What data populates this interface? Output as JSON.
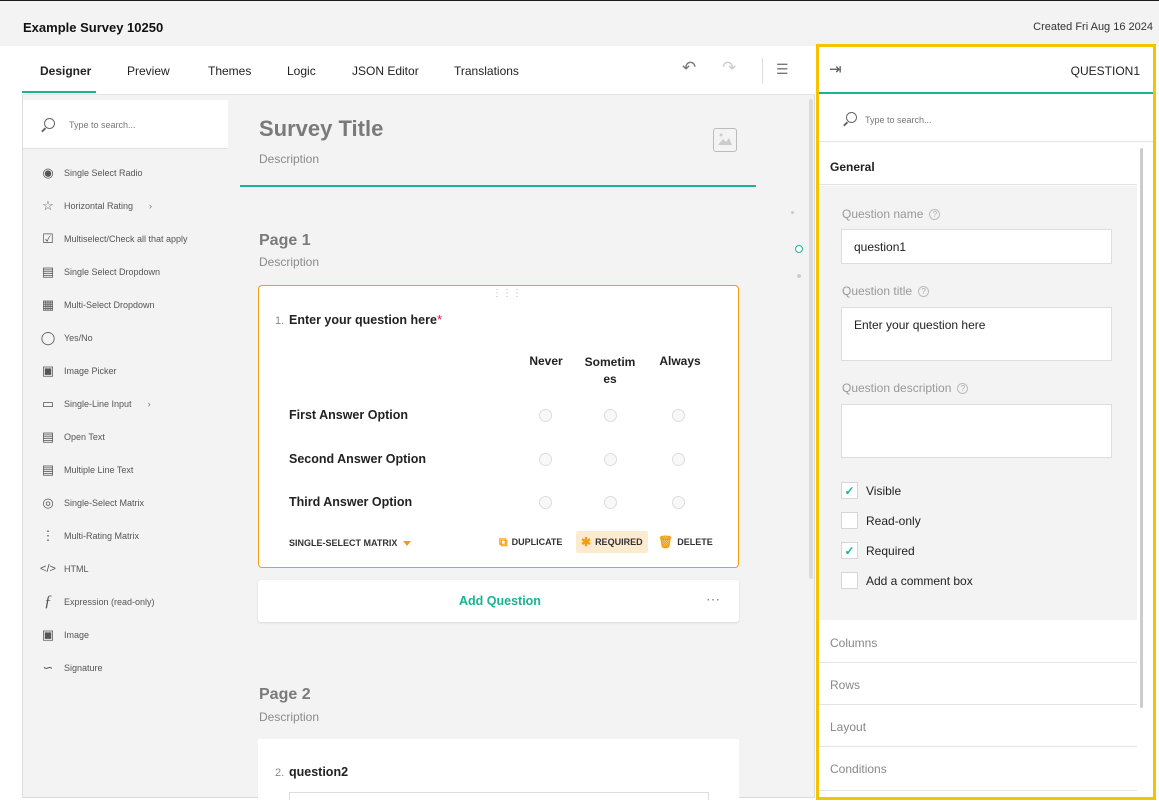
{
  "header": {
    "app_title": "Example Survey 10250",
    "created": "Created Fri Aug 16 2024"
  },
  "tabs": [
    "Designer",
    "Preview",
    "Themes",
    "Logic",
    "JSON Editor",
    "Translations"
  ],
  "toolbox": {
    "search_placeholder": "Type to search...",
    "items": [
      {
        "label": "Single Select Radio",
        "icon": "radio-icon",
        "has_sub": false
      },
      {
        "label": "Horizontal Rating",
        "icon": "star-icon",
        "has_sub": true
      },
      {
        "label": "Multiselect/Check all that apply",
        "icon": "checkbox-icon",
        "has_sub": false
      },
      {
        "label": "Single Select Dropdown",
        "icon": "dropdown-icon",
        "has_sub": false
      },
      {
        "label": "Multi-Select Dropdown",
        "icon": "multi-dropdown-icon",
        "has_sub": false
      },
      {
        "label": "Yes/No",
        "icon": "toggle-icon",
        "has_sub": false
      },
      {
        "label": "Image Picker",
        "icon": "image-picker-icon",
        "has_sub": false
      },
      {
        "label": "Single-Line Input",
        "icon": "text-input-icon",
        "has_sub": true
      },
      {
        "label": "Open Text",
        "icon": "comment-icon",
        "has_sub": false
      },
      {
        "label": "Multiple Line Text",
        "icon": "multiple-text-icon",
        "has_sub": false
      },
      {
        "label": "Single-Select Matrix",
        "icon": "matrix-icon",
        "has_sub": false
      },
      {
        "label": "Multi-Rating Matrix",
        "icon": "matrix-dropdown-icon",
        "has_sub": false
      },
      {
        "label": "HTML",
        "icon": "html-icon",
        "has_sub": false
      },
      {
        "label": "Expression (read-only)",
        "icon": "expression-icon",
        "has_sub": false
      },
      {
        "label": "Image",
        "icon": "image-icon",
        "has_sub": false
      },
      {
        "label": "Signature",
        "icon": "signature-icon",
        "has_sub": false
      }
    ]
  },
  "survey": {
    "title": "Survey Title",
    "description": "Description",
    "page1": {
      "title": "Page 1",
      "description": "Description"
    },
    "page2": {
      "title": "Page 2",
      "description": "Description"
    },
    "q1": {
      "number": "1.",
      "title": "Enter your question here",
      "required_mark": "*",
      "columns": [
        "Never",
        "Sometim es",
        "Always"
      ],
      "rows": [
        "First Answer Option",
        "Second Answer Option",
        "Third Answer Option"
      ],
      "type": "SINGLE-SELECT MATRIX",
      "actions": [
        "DUPLICATE",
        "REQUIRED",
        "DELETE"
      ]
    },
    "add_question": "Add Question",
    "q2": {
      "number": "2.",
      "title": "question2"
    }
  },
  "properties": {
    "question_label": "QUESTION1",
    "search_placeholder": "Type to search...",
    "general": "General",
    "name_label": "Question name",
    "name_value": "question1",
    "title_label": "Question title",
    "title_value": "Enter your question here",
    "desc_label": "Question description",
    "desc_value": "",
    "checks": [
      {
        "label": "Visible",
        "checked": true
      },
      {
        "label": "Read-only",
        "checked": false
      },
      {
        "label": "Required",
        "checked": true
      },
      {
        "label": "Add a comment box",
        "checked": false
      }
    ],
    "sections": [
      "Columns",
      "Rows",
      "Layout",
      "Conditions"
    ]
  },
  "colors": {
    "accent": "#19b394",
    "selected": "#f39c12",
    "highlight": "#f4c400",
    "required": "#e50a3e"
  }
}
